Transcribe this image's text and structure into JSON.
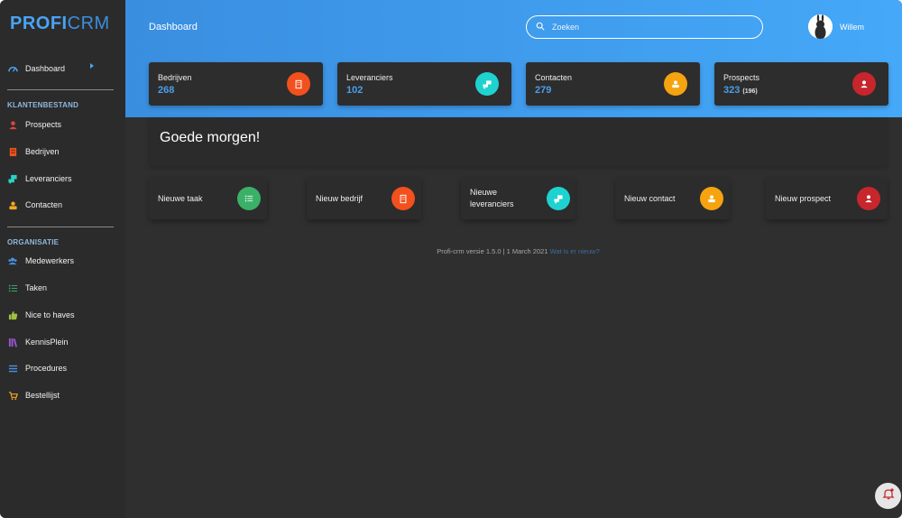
{
  "app": {
    "logo_part1": "PROFI",
    "logo_part2": "CRM"
  },
  "sidebar": {
    "dashboard": "Dashboard",
    "section1": "KLANTENBESTAND",
    "items1": [
      {
        "label": "Prospects",
        "icon": "user-icon",
        "color": "#e0443c"
      },
      {
        "label": "Bedrijven",
        "icon": "building-icon",
        "color": "#f2501d"
      },
      {
        "label": "Leveranciers",
        "icon": "truck-icon",
        "color": "#2bd3c6"
      },
      {
        "label": "Contacten",
        "icon": "contact-icon",
        "color": "#f5a623"
      }
    ],
    "section2": "ORGANISATIE",
    "items2": [
      {
        "label": "Medewerkers",
        "icon": "users-icon",
        "color": "#4a90e2"
      },
      {
        "label": "Taken",
        "icon": "checklist-icon",
        "color": "#3bb273"
      },
      {
        "label": "Nice to haves",
        "icon": "thumbs-up-icon",
        "color": "#a0c040"
      },
      {
        "label": "KennisPlein",
        "icon": "books-icon",
        "color": "#9b59d0"
      },
      {
        "label": "Procedures",
        "icon": "list-icon",
        "color": "#4a90e2"
      },
      {
        "label": "Bestellijst",
        "icon": "cart-icon",
        "color": "#f5a623"
      }
    ]
  },
  "header": {
    "title": "Dashboard",
    "search_placeholder": "Zoeken",
    "username": "Willem"
  },
  "stats": [
    {
      "label": "Bedrijven",
      "value": "268",
      "sub": "",
      "color": "#f2501d",
      "icon": "building-icon"
    },
    {
      "label": "Leveranciers",
      "value": "102",
      "sub": "",
      "color": "#1ed2cf",
      "icon": "truck-icon"
    },
    {
      "label": "Contacten",
      "value": "279",
      "sub": "",
      "color": "#f5a30f",
      "icon": "contact-icon"
    },
    {
      "label": "Prospects",
      "value": "323",
      "sub": "(196)",
      "color": "#c6262c",
      "icon": "user-icon"
    }
  ],
  "greeting": "Goede morgen!",
  "quick_actions": [
    {
      "label": "Nieuwe taak",
      "color": "#3bb068",
      "icon": "checklist-icon"
    },
    {
      "label": "Nieuw bedrijf",
      "color": "#f2501d",
      "icon": "building-icon"
    },
    {
      "label": "Nieuwe leveranciers",
      "line1": "Nieuwe",
      "line2": "leveranciers",
      "color": "#1ed2cf",
      "icon": "truck-icon"
    },
    {
      "label": "Nieuw contact",
      "color": "#f5a30f",
      "icon": "contact-icon"
    },
    {
      "label": "Nieuw prospect",
      "color": "#c6262c",
      "icon": "user-icon"
    }
  ],
  "footer": {
    "version_text": "Profi-crm versie 1.5.0 | 1 March 2021",
    "link_text": "Wat is er nieuw?"
  },
  "notification_icon": "bell-icon"
}
